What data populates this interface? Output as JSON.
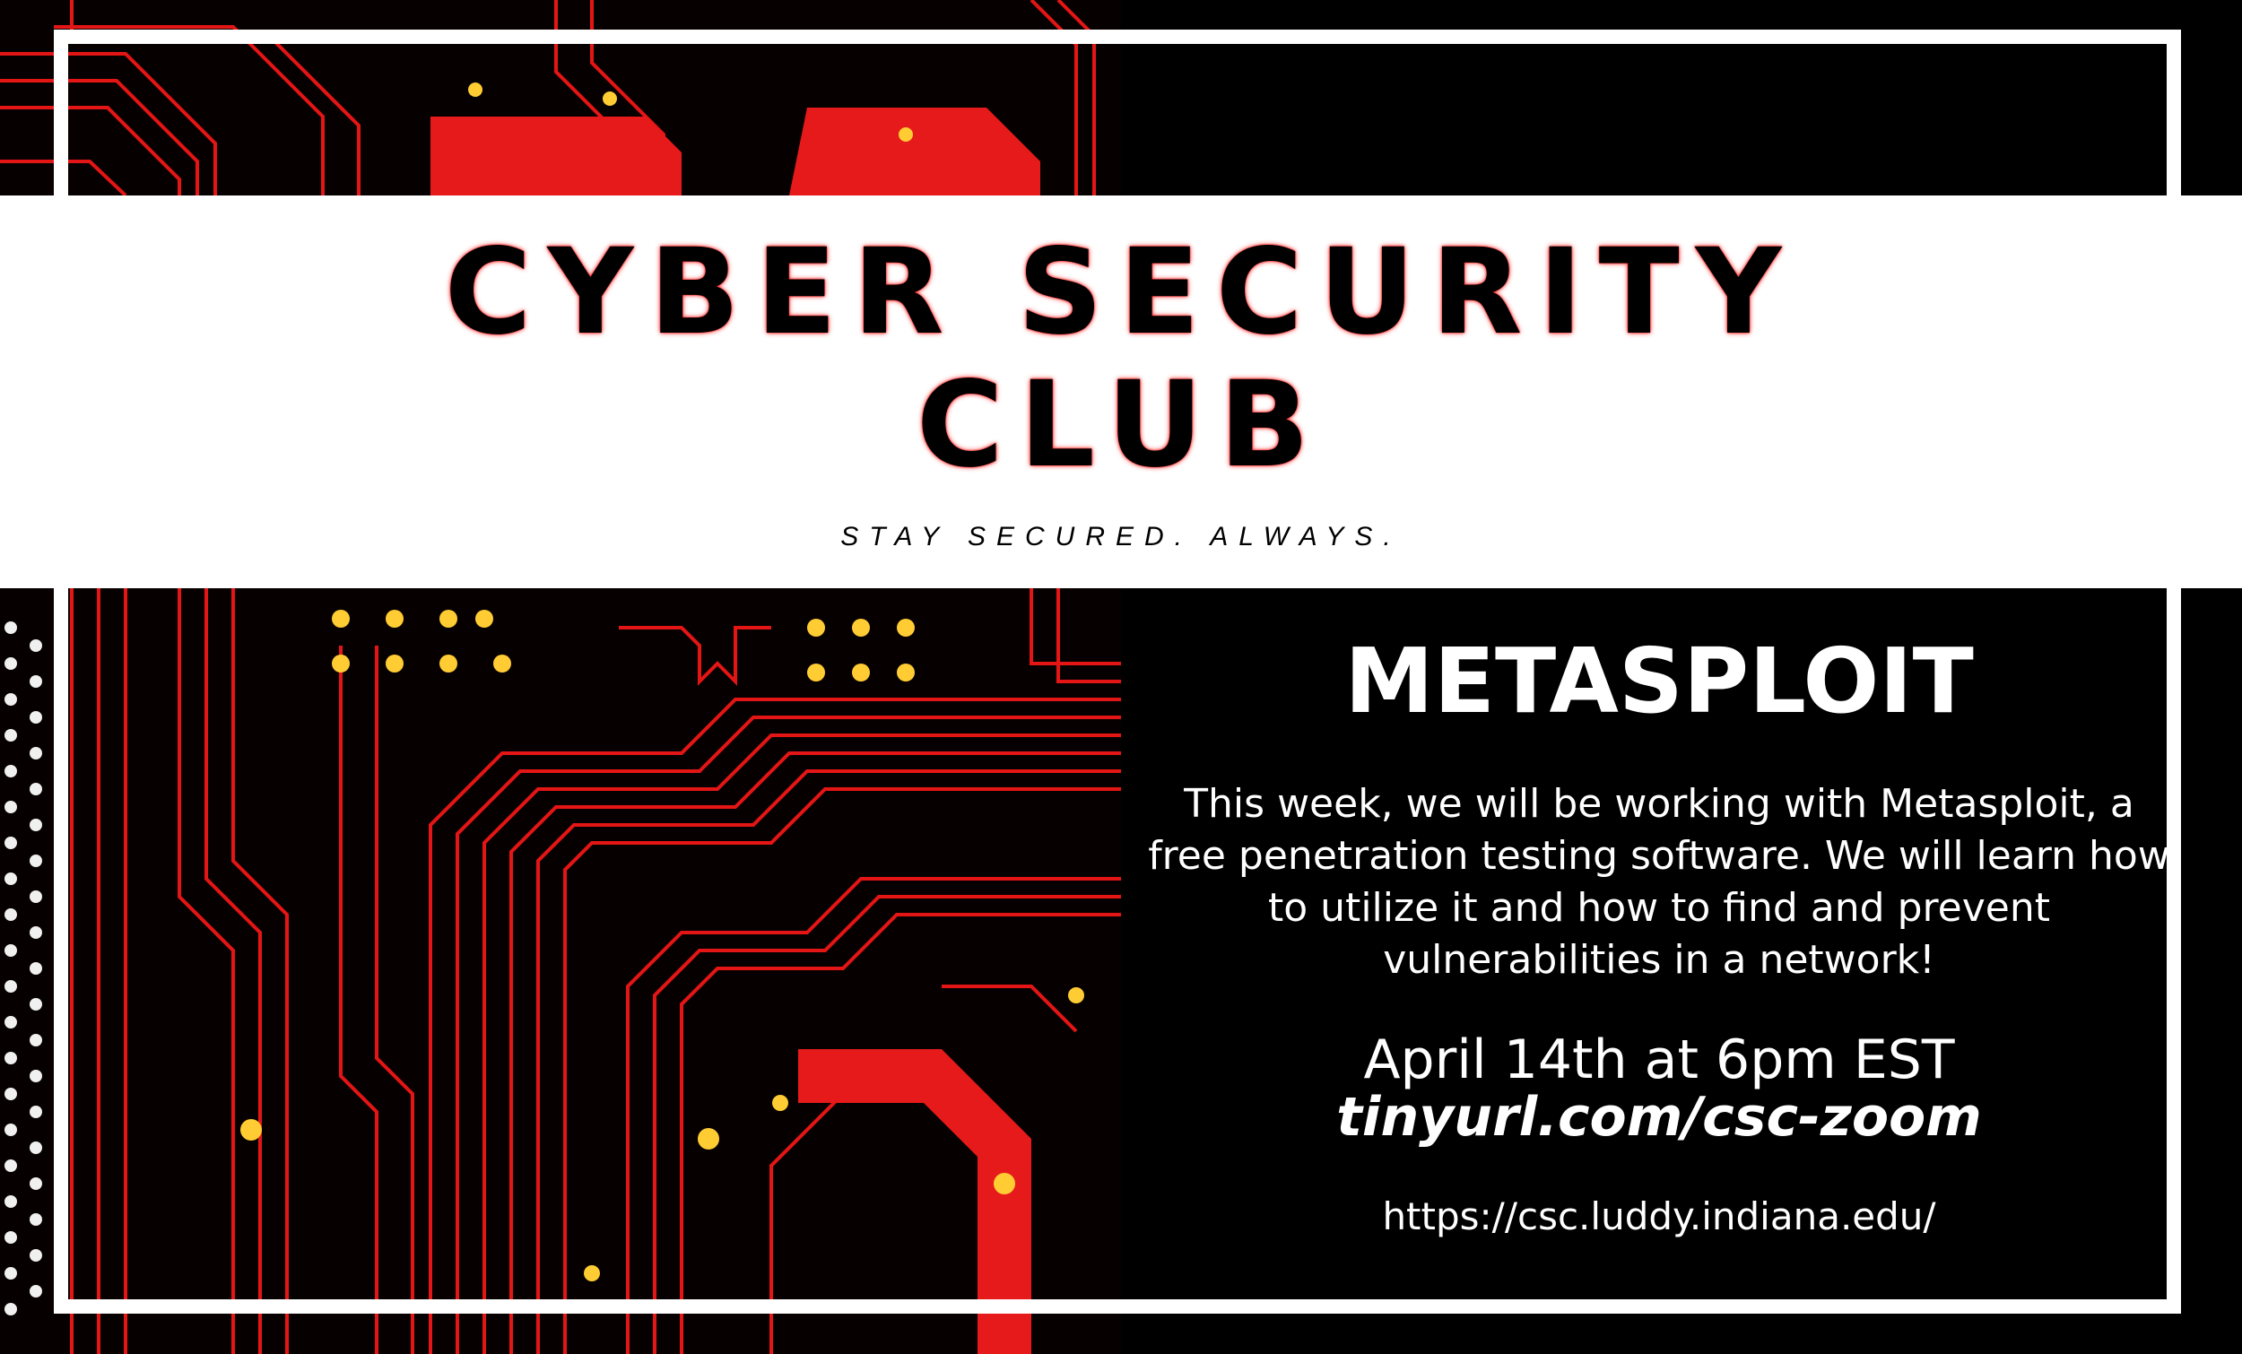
{
  "header": {
    "title_line1": "CYBER SECURITY",
    "title_line2": "CLUB",
    "tagline": "STAY SECURED. ALWAYS."
  },
  "event": {
    "title": "METASPLOIT",
    "description": "This week, we will be working with Metasploit, a free penetration testing software. We will learn how to utilize it and how to find and prevent vulnerabilities in a network!",
    "date": "April 14th at 6pm EST",
    "meeting_link": "tinyurl.com/csc-zoom",
    "website": "https://csc.luddy.indiana.edu/"
  },
  "colors": {
    "accent": "#ff1a1a",
    "background": "#000000",
    "banner": "#ffffff"
  }
}
